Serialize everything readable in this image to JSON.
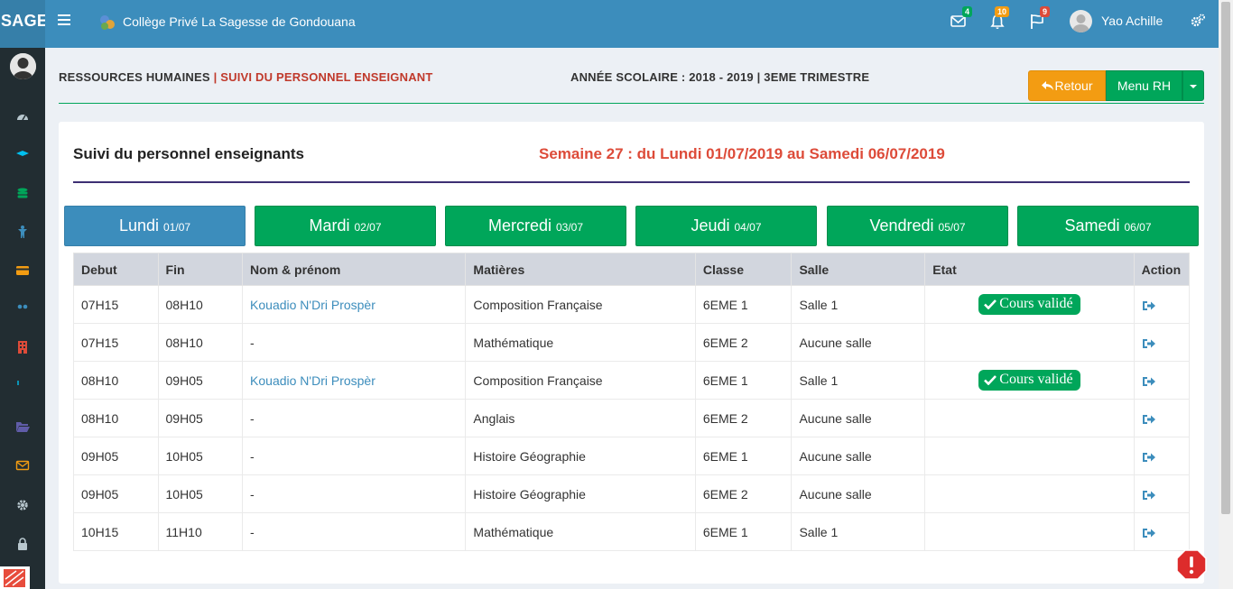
{
  "app": {
    "brand": "SAGE",
    "school_name": "Collège Privé La Sagesse de Gondouana",
    "user_name": "Yao Achille",
    "badges": {
      "messages": "4",
      "notifications": "10",
      "flags": "9"
    }
  },
  "header": {
    "section": "RESSOURCES HUMAINES",
    "separator": " | ",
    "page": "SUIVI DU PERSONNEL ENSEIGNANT",
    "school_year": "ANNÉE SCOLAIRE : 2018 - 2019 | 3EME TRIMESTRE",
    "btn_retour": "Retour",
    "btn_menu": "Menu RH"
  },
  "box": {
    "title": "Suivi du personnel enseignants",
    "week": "Semaine 27 : du Lundi 01/07/2019 au Samedi 06/07/2019"
  },
  "days": [
    {
      "name": "Lundi",
      "date": "01/07"
    },
    {
      "name": "Mardi",
      "date": "02/07"
    },
    {
      "name": "Mercredi",
      "date": "03/07"
    },
    {
      "name": "Jeudi",
      "date": "04/07"
    },
    {
      "name": "Vendredi",
      "date": "05/07"
    },
    {
      "name": "Samedi",
      "date": "06/07"
    }
  ],
  "table": {
    "headers": [
      "Debut",
      "Fin",
      "Nom & prénom",
      "Matières",
      "Classe",
      "Salle",
      "Etat",
      "Action"
    ],
    "rows": [
      {
        "debut": "07H15",
        "fin": "08H10",
        "nom": "Kouadio N'Dri Prospèr",
        "matiere": "Composition Française",
        "classe": "6EME 1",
        "salle": "Salle 1",
        "etat": "Cours validé"
      },
      {
        "debut": "07H15",
        "fin": "08H10",
        "nom": "-",
        "matiere": "Mathématique",
        "classe": "6EME 2",
        "salle": "Aucune salle",
        "etat": ""
      },
      {
        "debut": "08H10",
        "fin": "09H05",
        "nom": "Kouadio N'Dri Prospèr",
        "matiere": "Composition Française",
        "classe": "6EME 1",
        "salle": "Salle 1",
        "etat": "Cours validé"
      },
      {
        "debut": "08H10",
        "fin": "09H05",
        "nom": "-",
        "matiere": "Anglais",
        "classe": "6EME 2",
        "salle": "Aucune salle",
        "etat": ""
      },
      {
        "debut": "09H05",
        "fin": "10H05",
        "nom": "-",
        "matiere": "Histoire Géographie",
        "classe": "6EME 1",
        "salle": "Aucune salle",
        "etat": ""
      },
      {
        "debut": "09H05",
        "fin": "10H05",
        "nom": "-",
        "matiere": "Histoire Géographie",
        "classe": "6EME 2",
        "salle": "Aucune salle",
        "etat": ""
      },
      {
        "debut": "10H15",
        "fin": "11H10",
        "nom": "-",
        "matiere": "Mathématique",
        "classe": "6EME 1",
        "salle": "Salle 1",
        "etat": ""
      }
    ]
  },
  "icons": {
    "sidebar": [
      "dashboard-icon",
      "graduation-cap-icon",
      "database-icon",
      "child-icon",
      "credit-card-icon",
      "users-icon",
      "building-icon",
      "cutlery-icon",
      "folder-open-icon",
      "envelope-icon",
      "gear-icon",
      "lock-icon"
    ],
    "sidebar_colors": [
      "#b8c7ce",
      "#00c0ef",
      "#00a65a",
      "#3c8dbc",
      "#f39c12",
      "#3c8dbc",
      "#dd4b39",
      "#00c0ef",
      "#605ca8",
      "#f39c12",
      "#b8c7ce",
      "#b8c7ce"
    ]
  }
}
